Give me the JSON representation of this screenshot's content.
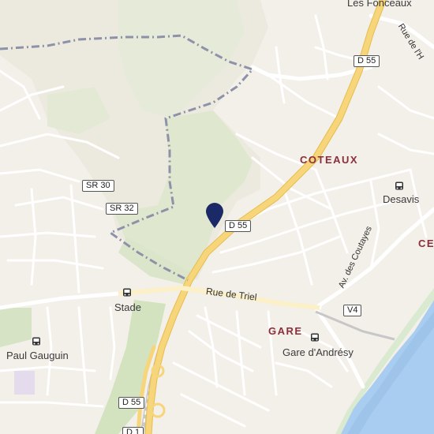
{
  "places": {
    "les_fonceaux": "Les Fonceaux",
    "coteaux": "COTEAUX",
    "gare": "GARE",
    "ce": "CE"
  },
  "stops": {
    "desavis": "Desavis",
    "stade": "Stade",
    "paul_gauguin": "Paul Gauguin",
    "gare_andresy": "Gare d'Andrésy"
  },
  "roads": {
    "d55_a": "D 55",
    "d55_b": "D 55",
    "d55_c": "D 55",
    "sr30": "SR 30",
    "sr32": "SR 32",
    "v4": "V4",
    "d1": "D 1"
  },
  "streets": {
    "rue_de_triel": "Rue de Triel",
    "av_des_coutayes": "Av. des Coutayes",
    "rue_de_l": "Rue de l'H"
  },
  "colors": {
    "land": "#f3efe9",
    "park": "#d7e4c6",
    "field": "#e9ecdb",
    "water": "#a9cdf0",
    "major_road": "#f7d57a",
    "boundary": "#8e92a8",
    "pin": "#1b2a66"
  },
  "icons": {
    "pin": "location-pin-icon",
    "bus": "bus-stop-icon"
  }
}
